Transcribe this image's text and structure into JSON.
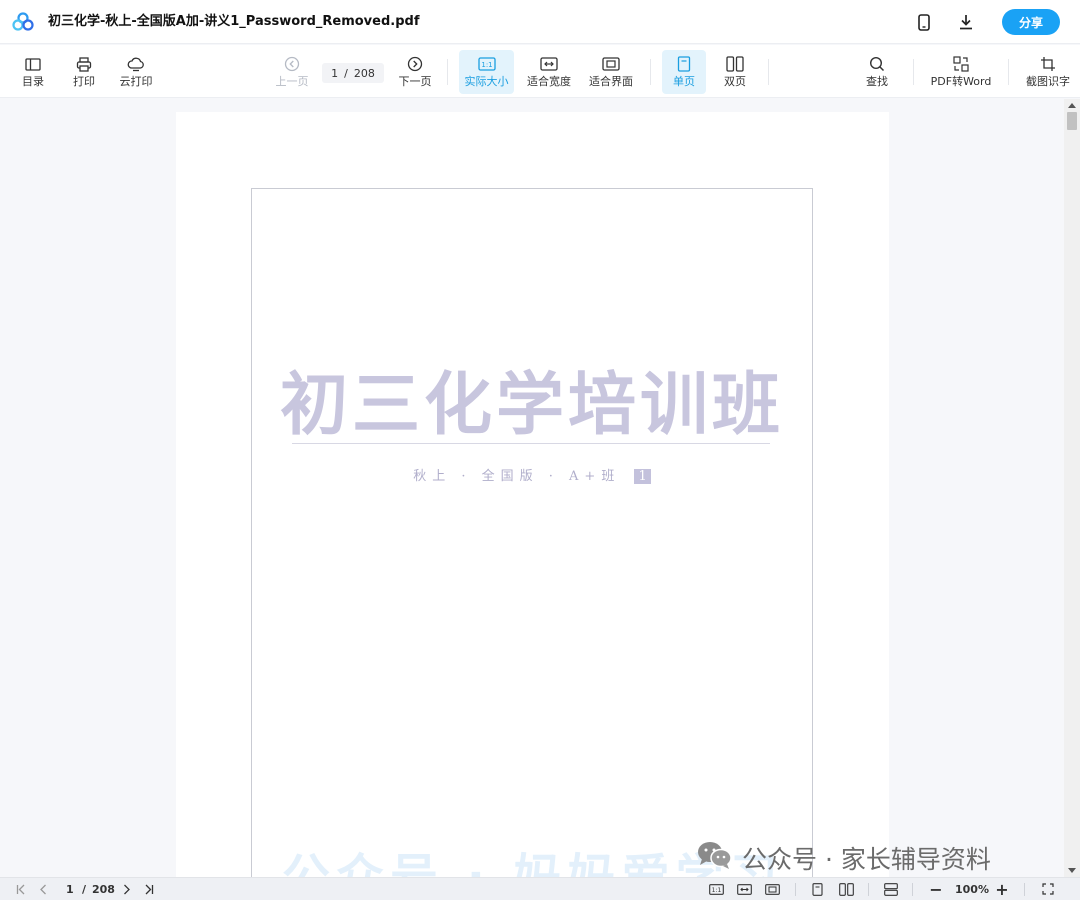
{
  "titlebar": {
    "doc_title": "初三化学-秋上-全国版A加-讲义1_Password_Removed.pdf",
    "share_label": "分享",
    "icons": [
      "app-logo-icon",
      "mobile-icon",
      "download-icon"
    ],
    "accent": "#1aa2f5"
  },
  "toolbar": {
    "toc_label": "目录",
    "print_label": "打印",
    "cloud_print_label": "云打印",
    "prev_label": "上一页",
    "current_page": "1",
    "page_separator": "/",
    "total_pages": "208",
    "next_label": "下一页",
    "actual_size_label": "实际大小",
    "fit_width_label": "适合宽度",
    "fit_page_label": "适合界面",
    "single_page_label": "单页",
    "double_page_label": "双页",
    "find_label": "查找",
    "pdf_to_word_label": "PDF转Word",
    "screenshot_ocr_label": "截图识字",
    "active_color": "#1a9ee0"
  },
  "document": {
    "cover_title": "初三化学培训班",
    "cover_subtitle": "秋上 · 全国版 · A+班",
    "cover_number": "1",
    "background_watermark": "公众号 · 妈妈爱学习"
  },
  "overlay": {
    "wechat_text": "公众号 · 家长辅导资料"
  },
  "statusbar": {
    "current_page": "1",
    "page_separator": "/",
    "total_pages": "208",
    "zoom": "100%",
    "zoom_out": "−",
    "zoom_in": "+"
  }
}
